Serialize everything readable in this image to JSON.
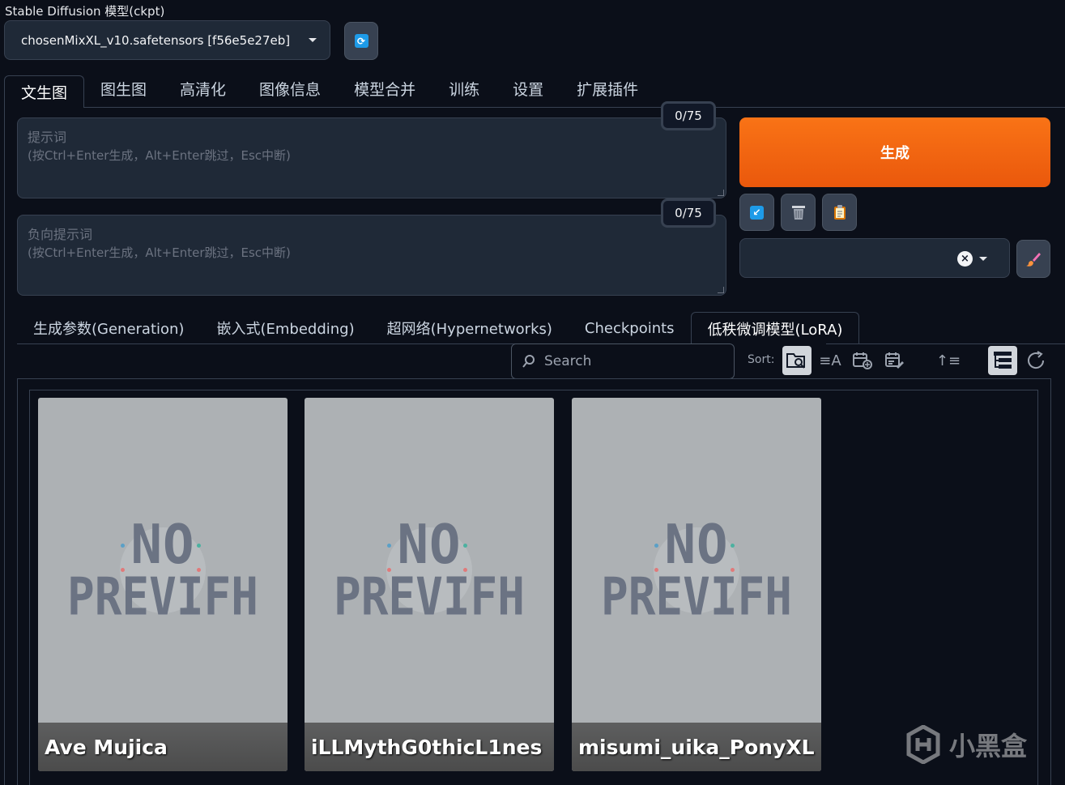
{
  "checkpoint": {
    "label": "Stable Diffusion 模型(ckpt)",
    "value": "chosenMixXL_v10.safetensors [f56e5e27eb]"
  },
  "main_tabs": [
    "文生图",
    "图生图",
    "高清化",
    "图像信息",
    "模型合并",
    "训练",
    "设置",
    "扩展插件"
  ],
  "prompt": {
    "placeholder_title": "提示词",
    "placeholder_hint": "(按Ctrl+Enter生成，Alt+Enter跳过，Esc中断)",
    "token_count": "0/75"
  },
  "negative_prompt": {
    "placeholder_title": "负向提示词",
    "placeholder_hint": "(按Ctrl+Enter生成，Alt+Enter跳过，Esc中断)",
    "token_count": "0/75"
  },
  "generate_label": "生成",
  "network_tabs": [
    "生成参数(Generation)",
    "嵌入式(Embedding)",
    "超网络(Hypernetworks)",
    "Checkpoints",
    "低秩微调模型(LoRA)"
  ],
  "search": {
    "placeholder": "Search"
  },
  "sort_label": "Sort:",
  "cards": [
    {
      "title": "Ave Mujica",
      "preview_text_1": "NO",
      "preview_text_2": "PREVIFH"
    },
    {
      "title": "iLLMythG0thicL1nes",
      "preview_text_1": "NO",
      "preview_text_2": "PREVIFH"
    },
    {
      "title": "misumi_uika_PonyXL",
      "preview_text_1": "NO",
      "preview_text_2": "PREVIFH"
    }
  ],
  "watermark": "小黑盒",
  "colors": {
    "background": "#0b0f19",
    "generate": "#f97316",
    "accent_blue": "#1e9be8"
  }
}
